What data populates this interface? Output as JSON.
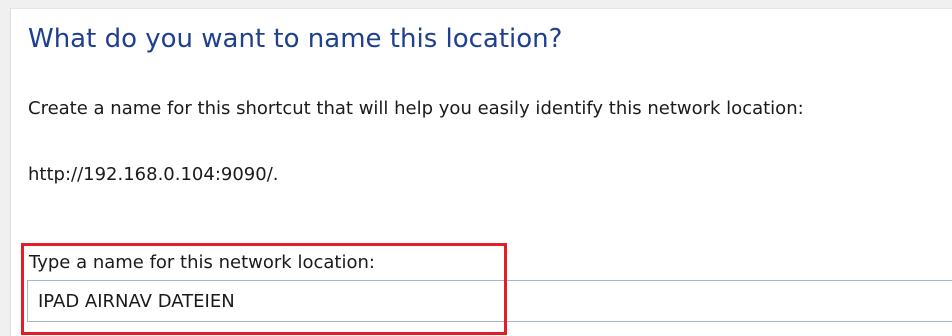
{
  "dialog": {
    "heading": "What do you want to name this location?",
    "description": "Create a name for this shortcut that will help you easily identify this network location:",
    "address": "http://192.168.0.104:9090/.",
    "field_label": "Type a name for this network location:",
    "field_value": "IPAD AIRNAV DATEIEN"
  },
  "colors": {
    "heading": "#1f3f8f",
    "highlight": "#e41e26",
    "input_border": "#a6b6cf"
  }
}
